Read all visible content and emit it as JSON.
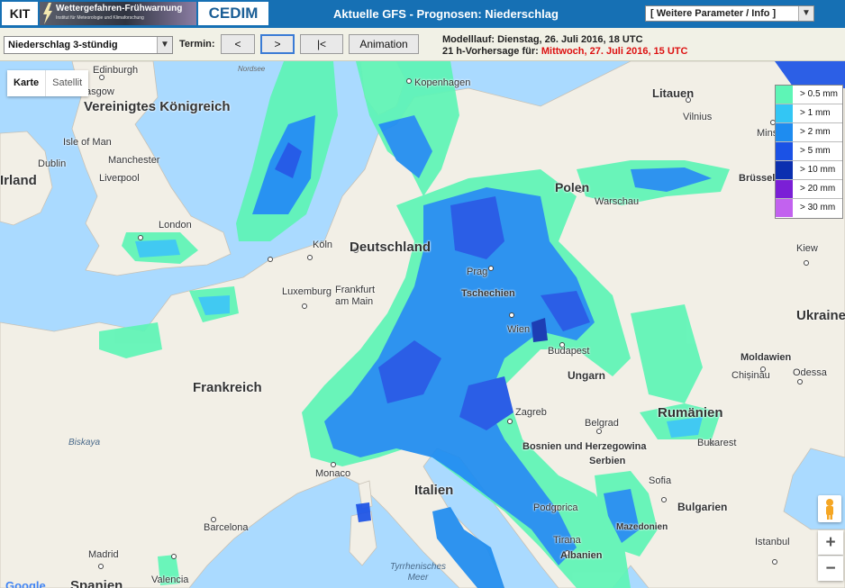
{
  "header": {
    "logo_kit": "KIT",
    "logo_wfw_title": "Wettergefahren-Frühwarnung",
    "logo_wfw_subtitle": "Institut für Meteorologie und Klimaforschung",
    "logo_cedim": "CEDIM",
    "title": "Aktuelle GFS - Prognosen: Niederschlag",
    "info_select": "[ Weitere Parameter / Info ]"
  },
  "toolbar": {
    "product_select": "Niederschlag 3-stündig",
    "termin_label": "Termin:",
    "btn_prev": "<",
    "btn_next": ">",
    "btn_first": "|<",
    "btn_animation": "Animation",
    "model_run": "Modelllauf: Dienstag, 26. Juli 2016, 18 UTC",
    "forecast_prefix": "21 h-Vorhersage für:",
    "forecast_valid": "Mittwoch, 27. Juli 2016, 15 UTC"
  },
  "maptype": {
    "karte": "Karte",
    "satellit": "Satellit"
  },
  "legend": [
    {
      "label": "> 0.5 mm",
      "color": "#5ef5b6"
    },
    {
      "label": "> 1 mm",
      "color": "#33c6f4"
    },
    {
      "label": "> 2 mm",
      "color": "#1e8cf0"
    },
    {
      "label": "> 5 mm",
      "color": "#1b52e6"
    },
    {
      "label": "> 10 mm",
      "color": "#0b2fb0"
    },
    {
      "label": "> 20 mm",
      "color": "#7b1fd6"
    },
    {
      "label": "> 30 mm",
      "color": "#c262ef"
    }
  ],
  "map": {
    "countries": [
      "Vereinigtes Königreich",
      "Irland",
      "Frankreich",
      "Deutschland",
      "Italien",
      "Spanien",
      "Ukraine",
      "Rumänien",
      "Ungarn",
      "Litauen",
      "Moldawien",
      "Bulgarien",
      "Polen",
      "Serbien",
      "Bosnien und Herzegowina",
      "Tschechien",
      "Albanien",
      "Mazedonien"
    ],
    "cities": [
      "Edinburgh",
      "Glasgow",
      "Isle of Man",
      "Manchester",
      "Liverpool",
      "Dublin",
      "London",
      "Köln",
      "Frankfurt am Main",
      "Luxemburg",
      "Kopenhagen",
      "Prag",
      "Wien",
      "Budapest",
      "Warschau",
      "Vilnius",
      "Minsk",
      "Kiew",
      "Chișinău",
      "Odessa",
      "Bukarest",
      "Belgrad",
      "Zagreb",
      "Sofia",
      "Podgorica",
      "Tirana",
      "Istanbul",
      "Barcelona",
      "Madrid",
      "Valencia",
      "Monaco",
      "Brüssel"
    ],
    "seas": [
      "Nordsee",
      "Biskaya",
      "Tyrrhenisches Meer"
    ]
  },
  "controls": {
    "zoom_in": "+",
    "zoom_out": "−"
  },
  "footer": {
    "google": "Google"
  }
}
